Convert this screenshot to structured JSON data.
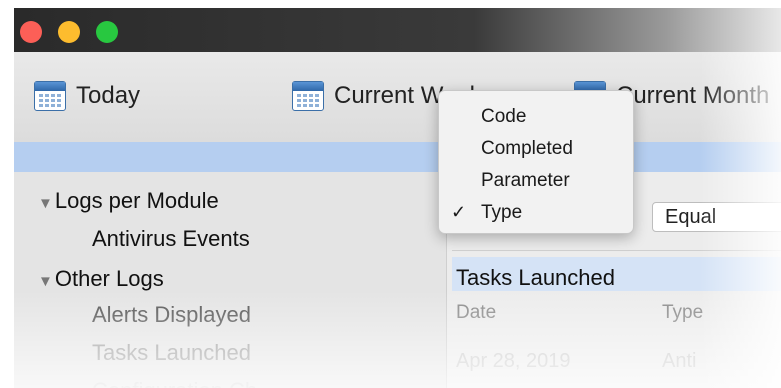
{
  "toolbar": {
    "today_label": "Today",
    "week_label": "Current Week",
    "month_label": "Current Month"
  },
  "sidebar": {
    "groups": [
      {
        "label": "Logs per Module",
        "items": [
          "Antivirus Events"
        ]
      },
      {
        "label": "Other Logs",
        "items": [
          "Alerts Displayed",
          "Tasks Launched",
          "Configuration Ch"
        ]
      }
    ]
  },
  "filter": {
    "operator": "Equal"
  },
  "section": {
    "title": "Tasks Launched"
  },
  "table": {
    "columns": [
      "Date",
      "Type"
    ],
    "rows": [
      [
        "Apr 28, 2019",
        "Anti"
      ]
    ]
  },
  "dropdown_menu": {
    "items": [
      {
        "label": "Code",
        "checked": false
      },
      {
        "label": "Completed",
        "checked": false
      },
      {
        "label": "Parameter",
        "checked": false
      },
      {
        "label": "Type",
        "checked": true
      }
    ],
    "check_glyph": "✓"
  },
  "colors": {
    "selection": "#b5cef0",
    "close": "#fc5f57",
    "minimize": "#fdbc2e",
    "zoom": "#28c840"
  }
}
